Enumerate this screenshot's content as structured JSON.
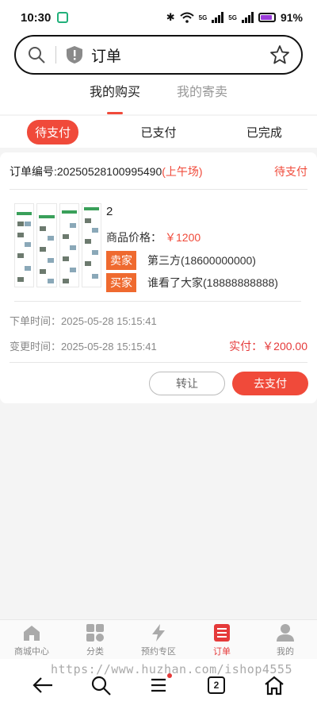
{
  "status_bar": {
    "time": "10:30",
    "network1": "5G",
    "network2": "5G",
    "battery": "91%"
  },
  "header": {
    "page_title": "订单"
  },
  "tabs": [
    {
      "label": "我的购买",
      "active": true
    },
    {
      "label": "我的寄卖",
      "active": false
    }
  ],
  "subtabs": [
    {
      "label": "待支付",
      "active": true
    },
    {
      "label": "已支付",
      "active": false
    },
    {
      "label": "已完成",
      "active": false
    }
  ],
  "order": {
    "number": "订单编号:20250528100995490",
    "session": "(上午场)",
    "status": "待支付",
    "product_title": "2",
    "price_label": "商品价格：",
    "price_value": "￥1200",
    "seller1_tag": "卖家",
    "seller1_name": "第三方(18600000000)",
    "seller2_tag": "买家",
    "seller2_name": "谁看了大家(18888888888)",
    "order_time": "下单时间：2025-05-28 15:15:41",
    "change_time": "变更时间：2025-05-28 15:15:41",
    "paid": "实付：￥200.00",
    "transfer_button": "转让",
    "pay_button": "去支付"
  },
  "tabbar": [
    {
      "label": "商城中心",
      "icon": "home-icon",
      "active": false
    },
    {
      "label": "分类",
      "icon": "grid-icon",
      "active": false
    },
    {
      "label": "预约专区",
      "icon": "lightning-icon",
      "active": false
    },
    {
      "label": "订单",
      "icon": "order-list-icon",
      "active": true
    },
    {
      "label": "我的",
      "icon": "user-icon",
      "active": false
    }
  ],
  "system_nav": {
    "watermark": "https://www.huzhan.com/ishop4555",
    "tab_count": "2"
  },
  "colors": {
    "accent": "#f04a3a",
    "tag": "#ef6a2f"
  }
}
